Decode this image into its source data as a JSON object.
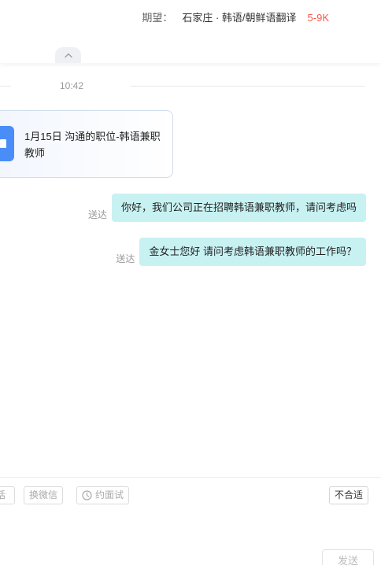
{
  "header": {
    "expect_label": "期望：",
    "expect_place": "石家庄 · 韩语/朝鲜语翻译",
    "expect_salary": "5-9K"
  },
  "chat": {
    "time": "10:42",
    "job_card": {
      "text": "1月15日 沟通的职位-韩语兼职教师"
    },
    "messages": [
      {
        "status": "送达",
        "text": "你好，我们公司正在招聘韩语兼职教师，请问考虑吗"
      },
      {
        "status": "送达",
        "text": "金女士您好 请问考虑韩语兼职教师的工作吗？"
      }
    ]
  },
  "toolbar": {
    "phone_label": "话",
    "wechat_label": "换微信",
    "interview_label": "约面试",
    "unfit_label": "不合适"
  },
  "composer": {
    "send_label": "发送"
  },
  "colors": {
    "salary": "#fe574a",
    "bubble": "#c8f1f2",
    "app_icon": "#4b8df8"
  }
}
